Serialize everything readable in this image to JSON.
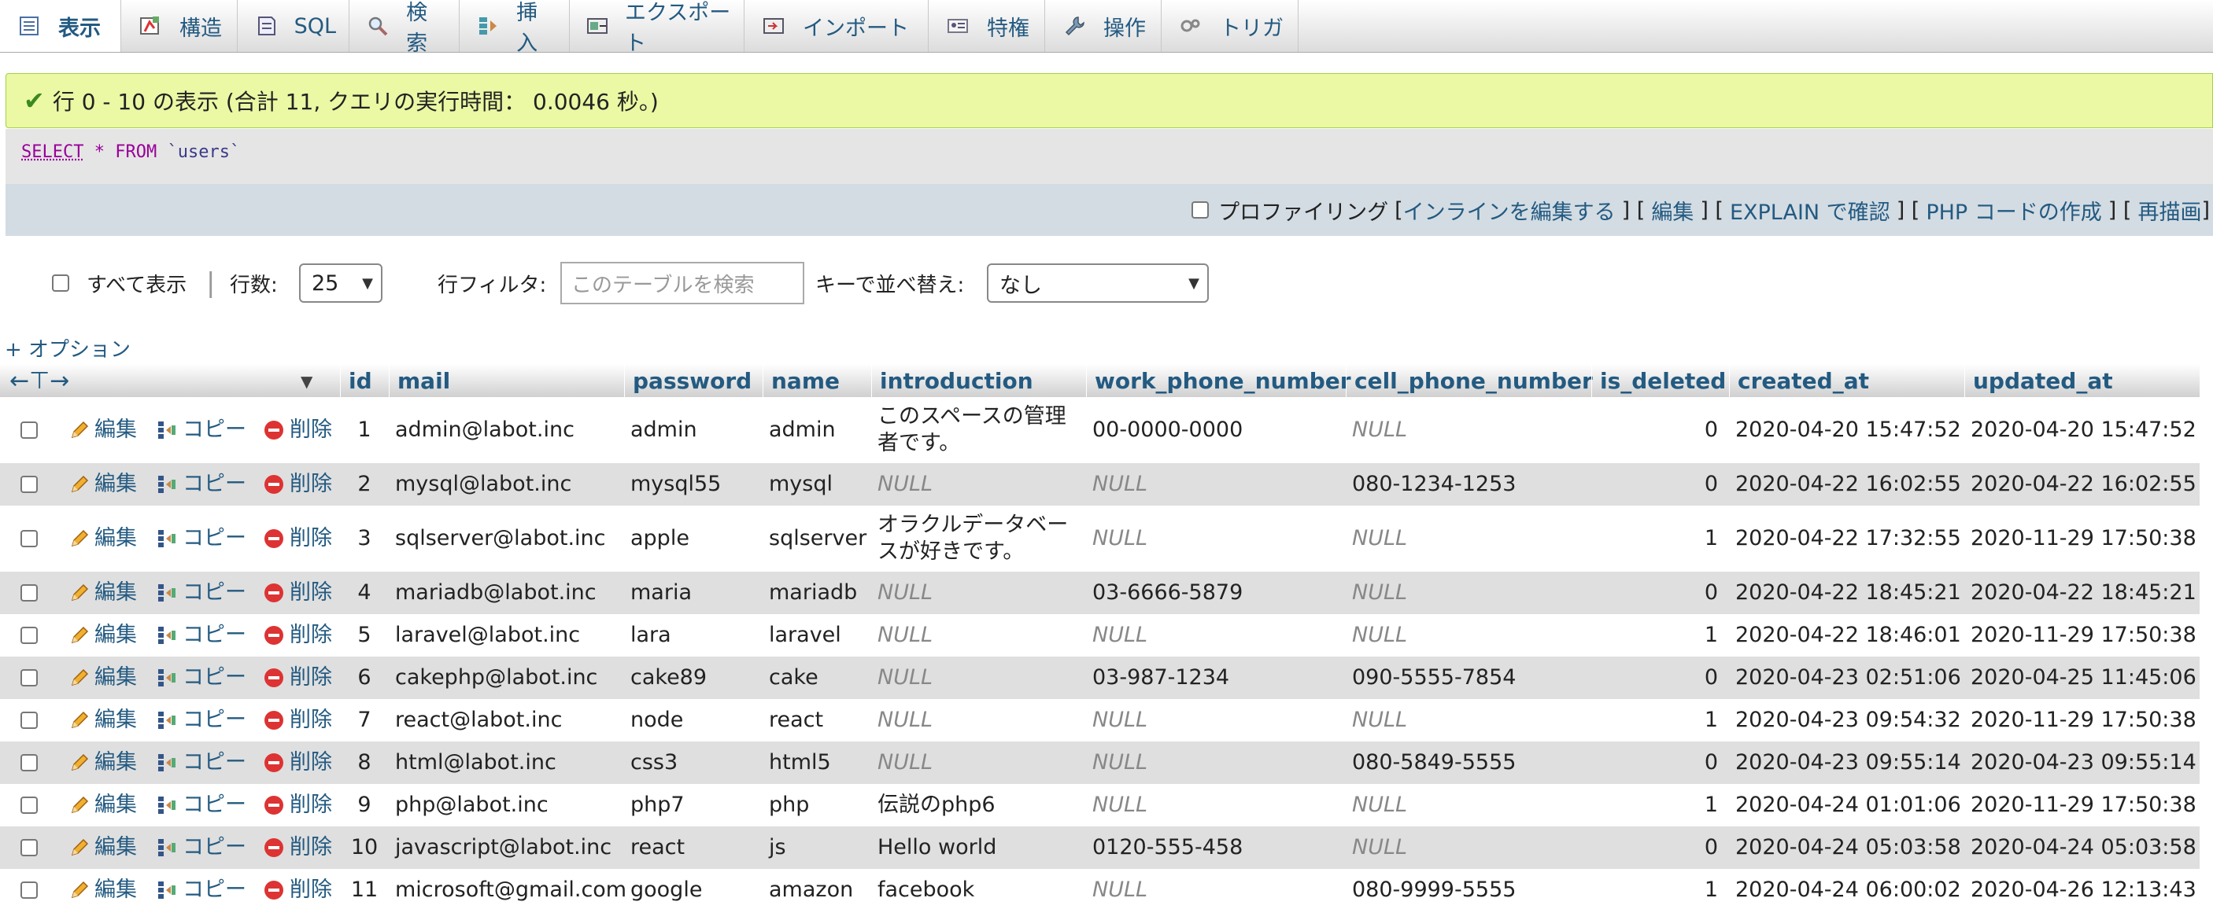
{
  "tabs": [
    {
      "label": "表示",
      "icon": "browse-icon",
      "active": true
    },
    {
      "label": "構造",
      "icon": "structure-icon",
      "active": false
    },
    {
      "label": "SQL",
      "icon": "sql-icon",
      "active": false
    },
    {
      "label": "検索",
      "icon": "search-icon",
      "active": false
    },
    {
      "label": "挿入",
      "icon": "insert-icon",
      "active": false
    },
    {
      "label": "エクスポート",
      "icon": "export-icon",
      "active": false
    },
    {
      "label": "インポート",
      "icon": "import-icon",
      "active": false
    },
    {
      "label": "特権",
      "icon": "privileges-icon",
      "active": false
    },
    {
      "label": "操作",
      "icon": "wrench-icon",
      "active": false
    },
    {
      "label": "トリガ",
      "icon": "triggers-icon",
      "active": false
    }
  ],
  "message": "行 0 - 10 の表示 (合計 11, クエリの実行時間： 0.0046 秒。)",
  "sql": {
    "select": "SELECT",
    "star": "*",
    "from": "FROM",
    "table": "`users`"
  },
  "actions": {
    "profiling": "プロファイリング",
    "lb1": "[",
    "inline_edit": "インラインを編集する",
    "rb1": "] [",
    "edit": "編集",
    "rb2": "] [",
    "explain": "EXPLAIN で確認",
    "rb3": "] [",
    "php": "PHP コードの作成",
    "rb4": "] [",
    "refresh": "再描画",
    "rb5": "]"
  },
  "nav": {
    "show_all": "すべて表示",
    "separator": "|",
    "rows_label": "行数:",
    "rows_value": "25",
    "filter_label": "行フィルタ:",
    "filter_placeholder": "このテーブルを検索",
    "sort_label": "キーで並べ替え:",
    "sort_value": "なし"
  },
  "options_link": "+ オプション",
  "row_actions": {
    "edit": "編集",
    "copy": "コピー",
    "delete": "削除"
  },
  "columns": [
    "id",
    "mail",
    "password",
    "name",
    "introduction",
    "work_phone_number",
    "cell_phone_number",
    "is_deleted",
    "created_at",
    "updated_at"
  ],
  "rows": [
    [
      "1",
      "admin@labot.inc",
      "admin",
      "admin",
      "このスペースの管理者です。",
      "00-0000-0000",
      "NULL",
      "0",
      "2020-04-20 15:47:52",
      "2020-04-20 15:47:52"
    ],
    [
      "2",
      "mysql@labot.inc",
      "mysql55",
      "mysql",
      "NULL",
      "NULL",
      "080-1234-1253",
      "0",
      "2020-04-22 16:02:55",
      "2020-04-22 16:02:55"
    ],
    [
      "3",
      "sqlserver@labot.inc",
      "apple",
      "sqlserver",
      "オラクルデータベースが好きです。",
      "NULL",
      "NULL",
      "1",
      "2020-04-22 17:32:55",
      "2020-11-29 17:50:38"
    ],
    [
      "4",
      "mariadb@labot.inc",
      "maria",
      "mariadb",
      "NULL",
      "03-6666-5879",
      "NULL",
      "0",
      "2020-04-22 18:45:21",
      "2020-04-22 18:45:21"
    ],
    [
      "5",
      "laravel@labot.inc",
      "lara",
      "laravel",
      "NULL",
      "NULL",
      "NULL",
      "1",
      "2020-04-22 18:46:01",
      "2020-11-29 17:50:38"
    ],
    [
      "6",
      "cakephp@labot.inc",
      "cake89",
      "cake",
      "NULL",
      "03-987-1234",
      "090-5555-7854",
      "0",
      "2020-04-23 02:51:06",
      "2020-04-25 11:45:06"
    ],
    [
      "7",
      "react@labot.inc",
      "node",
      "react",
      "NULL",
      "NULL",
      "NULL",
      "1",
      "2020-04-23 09:54:32",
      "2020-11-29 17:50:38"
    ],
    [
      "8",
      "html@labot.inc",
      "css3",
      "html5",
      "NULL",
      "NULL",
      "080-5849-5555",
      "0",
      "2020-04-23 09:55:14",
      "2020-04-23 09:55:14"
    ],
    [
      "9",
      "php@labot.inc",
      "php7",
      "php",
      "伝説のphp6",
      "NULL",
      "NULL",
      "1",
      "2020-04-24 01:01:06",
      "2020-11-29 17:50:38"
    ],
    [
      "10",
      "javascript@labot.inc",
      "react",
      "js",
      "Hello world",
      "0120-555-458",
      "NULL",
      "0",
      "2020-04-24 05:03:58",
      "2020-04-24 05:03:58"
    ],
    [
      "11",
      "microsoft@gmail.com",
      "google",
      "amazon",
      "facebook",
      "NULL",
      "080-9999-5555",
      "1",
      "2020-04-24 06:00:02",
      "2020-04-26 12:13:43"
    ]
  ],
  "colors": {
    "link": "#235a81",
    "success_bg": "#ebf8a4",
    "null_text": "#888888",
    "row_alt": "#dfdfdf"
  }
}
